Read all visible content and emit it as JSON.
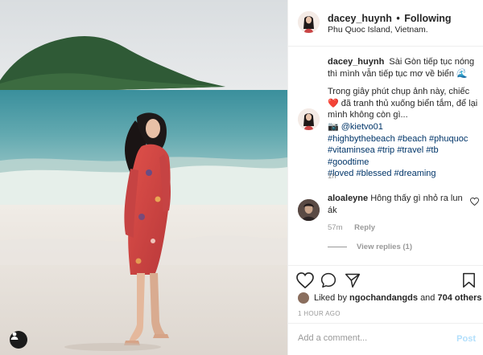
{
  "post": {
    "username": "dacey_huynh",
    "separator": "•",
    "follow_status": "Following",
    "location": "Phu Quoc Island, Vietnam."
  },
  "caption": {
    "username": "dacey_huynh",
    "line1": "Sài Gòn tiếp tục nóng thì mình vẫn tiếp tục mơ về biển 🌊",
    "line2": "Trong giây phút chụp ảnh này, chiếc ❤️ đã tranh thủ xuống biển tắm, để lại mình không còn gì...",
    "credit_prefix": "📷",
    "mention": "@kietvo01",
    "hashtags_1": "#highbythebeach #beach #phuquoc",
    "hashtags_2": "#vitaminsea #trip #travel #tb #goodtime",
    "hashtags_3": "#loved #blessed #dreaming",
    "time": "1h"
  },
  "comment": {
    "username": "aloaleyne",
    "text": "Hông thấy gì nhỏ ra lun ák",
    "time": "57m",
    "reply_label": "Reply",
    "view_replies": "View replies (1)"
  },
  "likes": {
    "prefix": "Liked by",
    "user": "ngochandangds",
    "and": "and",
    "count": "704 others"
  },
  "post_time": "1 HOUR AGO",
  "comment_box": {
    "placeholder": "Add a comment...",
    "post_label": "Post"
  },
  "colors": {
    "link": "#003569",
    "muted": "#999999",
    "post_button": "#b2dffc",
    "border": "#efefef"
  },
  "icons": {
    "like": "heart-icon",
    "comment": "comment-icon",
    "share": "share-icon",
    "save": "bookmark-icon",
    "tag": "user-tag-icon"
  }
}
